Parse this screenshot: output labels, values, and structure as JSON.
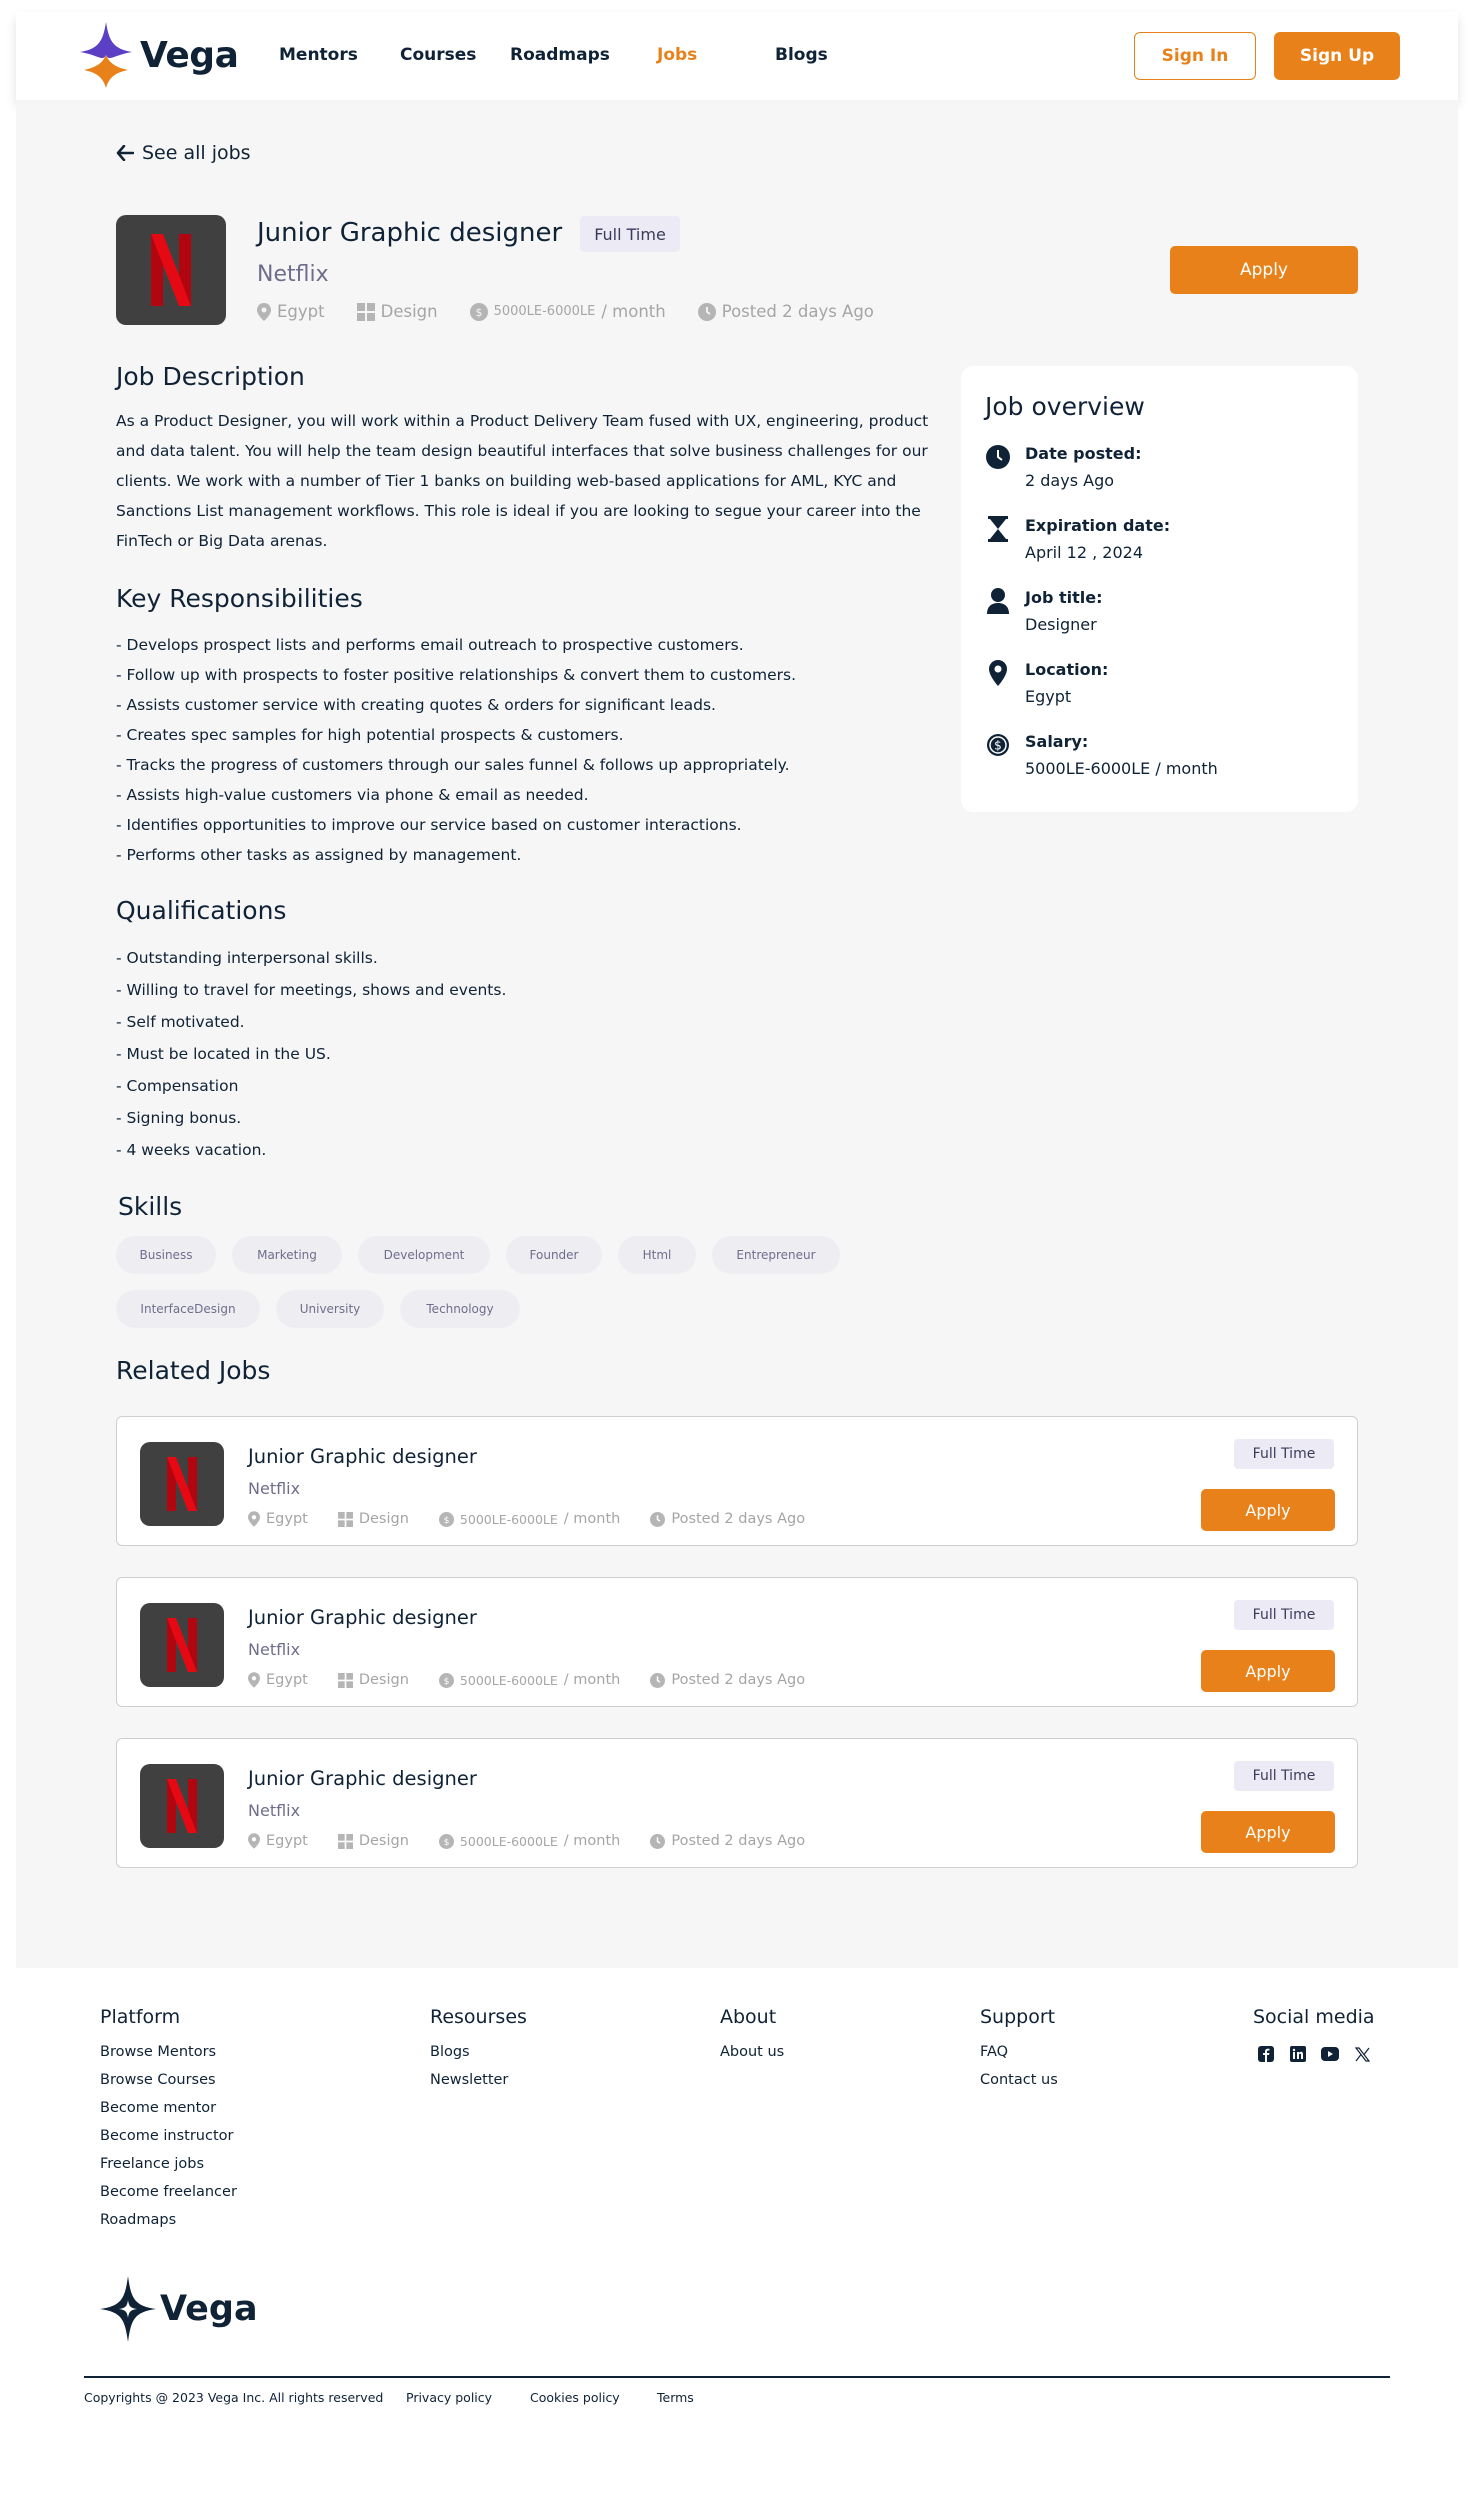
{
  "brand": {
    "name": "Vega"
  },
  "nav": {
    "items": [
      "Mentors",
      "Courses",
      "Roadmaps",
      "Jobs",
      "Blogs"
    ],
    "active": "Jobs",
    "sign_in": "Sign In",
    "sign_up": "Sign Up"
  },
  "back_link": "See all jobs",
  "job": {
    "title": "Junior Graphic designer",
    "type": "Full Time",
    "company": "Netflix",
    "location": "Egypt",
    "category": "Design",
    "salary": "5000LE-6000LE",
    "salary_unit": " / month",
    "posted": "Posted 2 days Ago",
    "apply": "Apply"
  },
  "description": {
    "title": "Job Description",
    "text": "As a Product Designer, you will work within a Product Delivery Team fused with UX, engineering, product and data talent. You will help the team design beautiful interfaces that solve business challenges for our clients. We work with a number of Tier 1 banks on building web-based applications for AML, KYC and Sanctions List management workflows. This role is ideal if you are looking to segue your career into the FinTech or Big Data arenas."
  },
  "responsibilities": {
    "title": "Key Responsibilities",
    "items": [
      "- Develops prospect lists and performs email outreach to prospective customers.",
      "- Follow up with prospects to foster positive relationships & convert them to customers.",
      "- Assists customer service with creating quotes & orders for significant leads.",
      "- Creates spec samples for high potential prospects & customers.",
      "- Tracks the progress of customers through our sales funnel & follows up appropriately.",
      "- Assists high-value customers via phone & email as needed.",
      "- Identifies opportunities to improve our service based on customer interactions.",
      "- Performs other tasks as assigned by management."
    ]
  },
  "qualifications": {
    "title": "Qualifications",
    "items": [
      "- Outstanding interpersonal skills.",
      "- Willing to travel for meetings, shows and events.",
      "- Self motivated.",
      "- Must be located in the US.",
      "- Compensation",
      "- Signing bonus.",
      "- 4 weeks vacation."
    ]
  },
  "overview": {
    "title": "Job overview",
    "items": [
      {
        "label": "Date posted:",
        "value": "2 days Ago",
        "icon": "clock-icon"
      },
      {
        "label": "Expiration date:",
        "value": "April 12 , 2024",
        "icon": "hourglass-icon"
      },
      {
        "label": "Job title:",
        "value": "Designer",
        "icon": "user-icon"
      },
      {
        "label": "Location:",
        "value": "Egypt",
        "icon": "map-pin-icon"
      },
      {
        "label": "Salary:",
        "value": "5000LE-6000LE / month",
        "icon": "dollar-icon"
      }
    ]
  },
  "skills": {
    "title": "Skills",
    "items": [
      "Business",
      "Marketing",
      "Development",
      "Founder",
      "Html",
      "Entrepreneur",
      "InterfaceDesign",
      "University",
      "Technology"
    ]
  },
  "related": {
    "title": "Related Jobs",
    "jobs": [
      {
        "title": "Junior Graphic designer",
        "company": "Netflix",
        "type": "Full Time",
        "location": "Egypt",
        "category": "Design",
        "salary": "5000LE-6000LE",
        "salary_unit": " / month",
        "posted": "Posted 2 days Ago",
        "apply": "Apply"
      },
      {
        "title": "Junior Graphic designer",
        "company": "Netflix",
        "type": "Full Time",
        "location": "Egypt",
        "category": "Design",
        "salary": "5000LE-6000LE",
        "salary_unit": " / month",
        "posted": "Posted 2 days Ago",
        "apply": "Apply"
      },
      {
        "title": "Junior Graphic designer",
        "company": "Netflix",
        "type": "Full Time",
        "location": "Egypt",
        "category": "Design",
        "salary": "5000LE-6000LE",
        "salary_unit": " / month",
        "posted": "Posted 2 days Ago",
        "apply": "Apply"
      }
    ]
  },
  "footer": {
    "platform": {
      "title": "Platform",
      "links": [
        "Browse Mentors",
        "Browse Courses",
        "Become mentor",
        "Become instructor",
        "Freelance jobs",
        "Become freelancer",
        "Roadmaps"
      ]
    },
    "resources": {
      "title": "Resourses",
      "links": [
        "Blogs",
        "Newsletter"
      ]
    },
    "about": {
      "title": "About",
      "links": [
        "About us"
      ]
    },
    "support": {
      "title": "Support",
      "links": [
        "FAQ",
        "Contact us"
      ]
    },
    "social": {
      "title": "Social media",
      "icons": [
        "facebook-icon",
        "linkedin-icon",
        "youtube-icon",
        "x-icon"
      ]
    },
    "copyright": "Copyrights @ 2023 Vega Inc. All rights reserved",
    "privacy": "Privacy policy",
    "cookies": "Cookies policy",
    "terms": "Terms"
  },
  "colors": {
    "accent": "#e8811a",
    "navy": "#0f2236",
    "muted": "#6f6d8c",
    "brand_purple": "#5b3fc4"
  }
}
